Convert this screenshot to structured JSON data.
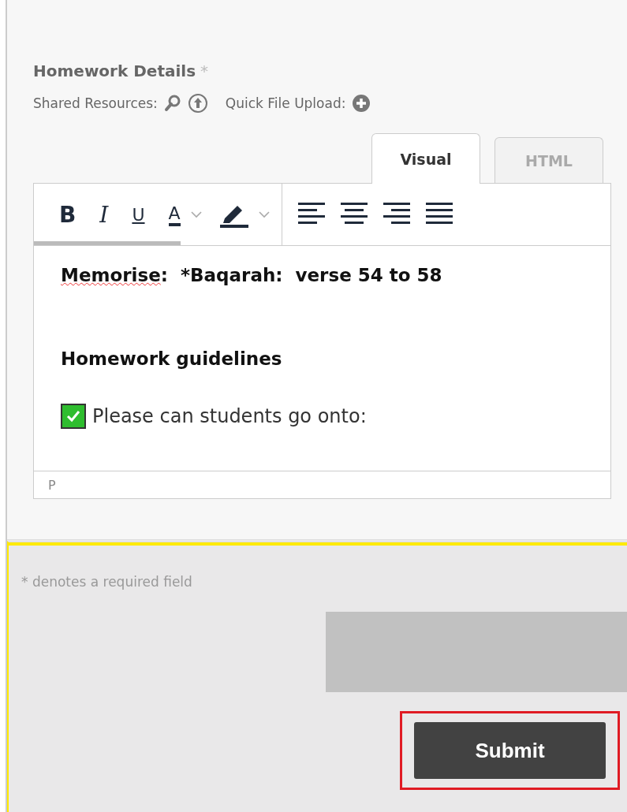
{
  "field": {
    "label": "Homework Details",
    "required_mark": "*"
  },
  "resources": {
    "shared_label": "Shared Resources:",
    "upload_label": "Quick File Upload:"
  },
  "tabs": [
    {
      "label": "Visual",
      "selected": true
    },
    {
      "label": "HTML",
      "selected": false
    }
  ],
  "toolbar": [
    {
      "kind": "bold",
      "label": "B"
    },
    {
      "kind": "italic",
      "label": "I"
    },
    {
      "kind": "underline",
      "label": "U"
    },
    {
      "kind": "text-color",
      "label": "A"
    },
    {
      "kind": "dropdown"
    },
    {
      "kind": "highlight"
    },
    {
      "kind": "dropdown"
    },
    {
      "kind": "separator"
    },
    {
      "kind": "align-left"
    },
    {
      "kind": "align-center"
    },
    {
      "kind": "align-right"
    },
    {
      "kind": "justify"
    }
  ],
  "content": [
    {
      "kind": "paragraph",
      "parts": [
        {
          "text": "Memorise",
          "misspelled": true
        },
        {
          "text": ":  *Baqarah:  verse 54 to 58",
          "misspelled": false
        }
      ]
    },
    {
      "kind": "heading",
      "text": "Homework guidelines"
    },
    {
      "kind": "check",
      "checked": true,
      "text": "Please can students go onto:"
    }
  ],
  "status_path": "P",
  "footer": {
    "note": "* denotes a required field",
    "submit": "Submit"
  }
}
